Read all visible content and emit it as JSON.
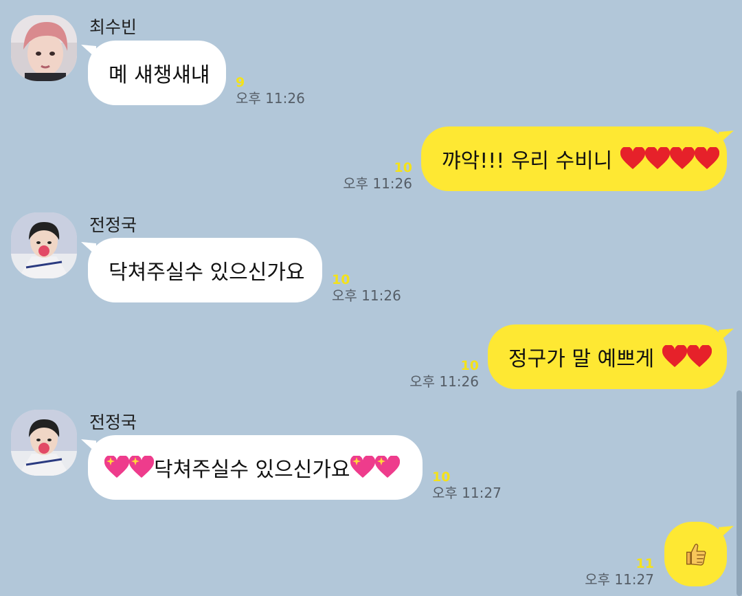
{
  "messages": [
    {
      "type": "incoming",
      "sender": "최수빈",
      "text": "몌 섀챙섀냬",
      "unread": "9",
      "time": "오후 11:26"
    },
    {
      "type": "outgoing",
      "text": "꺄악!!! 우리 수비니",
      "emoji_trailing": [
        "heart-icon",
        "heart-icon",
        "heart-icon",
        "heart-icon"
      ],
      "unread": "10",
      "time": "오후 11:26"
    },
    {
      "type": "incoming",
      "sender": "전정국",
      "text": "닥쳐주실수 있으신가요",
      "unread": "10",
      "time": "오후 11:26"
    },
    {
      "type": "outgoing",
      "text": "정구가 말 예쁘게",
      "emoji_trailing": [
        "heart-icon",
        "heart-icon"
      ],
      "unread": "10",
      "time": "오후 11:26"
    },
    {
      "type": "incoming",
      "sender": "전정국",
      "text": "닥쳐주실수 있으신가요",
      "emoji_leading": [
        "sparkling-heart-icon",
        "sparkling-heart-icon"
      ],
      "emoji_trailing": [
        "sparkling-heart-icon",
        "sparkling-heart-icon"
      ],
      "unread": "10",
      "time": "오후 11:27"
    },
    {
      "type": "outgoing",
      "text": "",
      "emoji_trailing": [
        "thumbs-up-icon"
      ],
      "unread": "11",
      "time": "오후 11:27"
    }
  ],
  "colors": {
    "background": "#b2c7d9",
    "incoming_bubble": "#ffffff",
    "outgoing_bubble": "#fee833",
    "unread_count": "#f4e21a",
    "timestamp": "#555d66"
  }
}
